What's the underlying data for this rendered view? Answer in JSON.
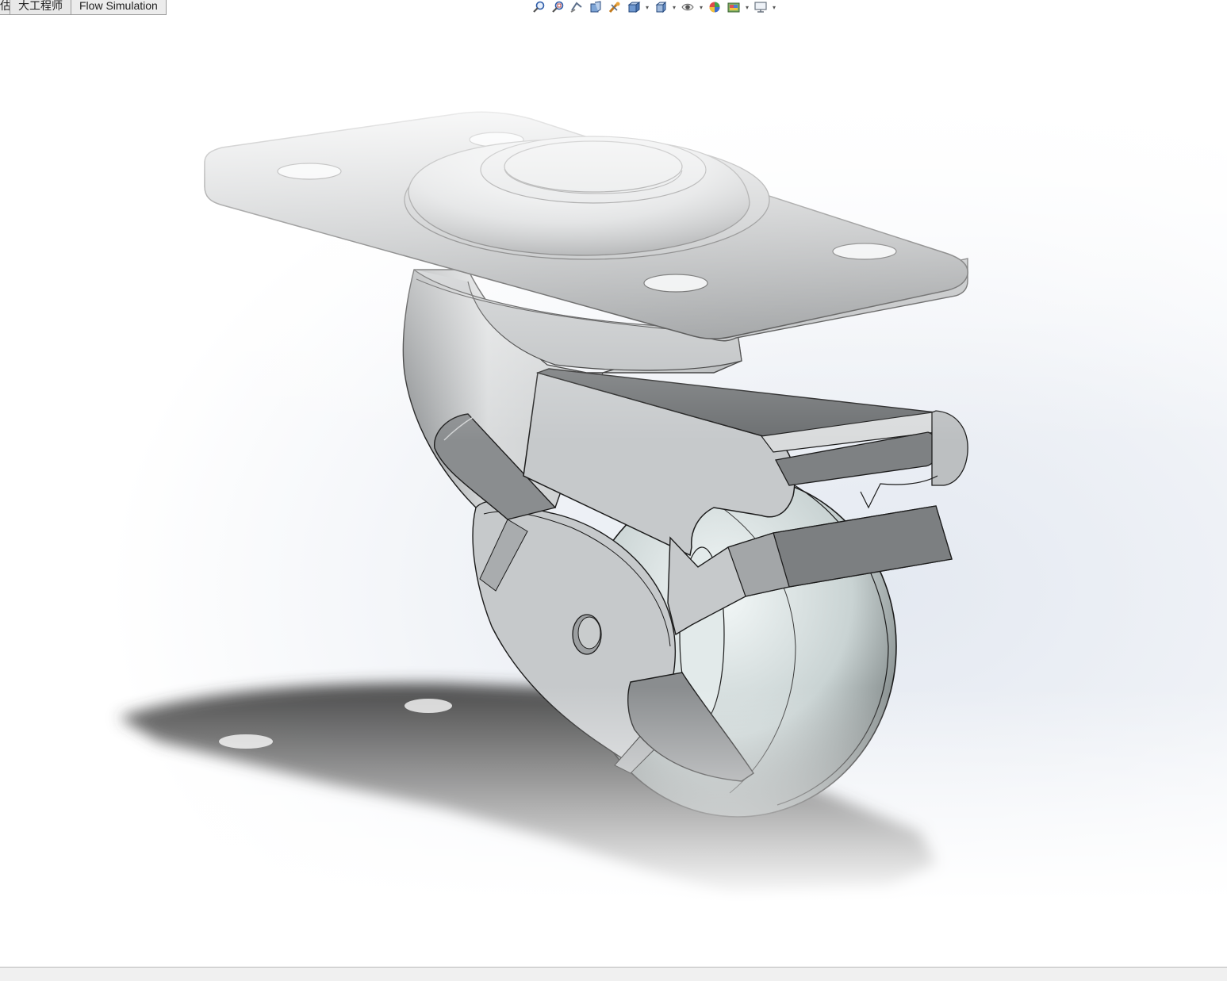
{
  "tabs": [
    {
      "label": "评估"
    },
    {
      "label": "大工程师"
    },
    {
      "label": "Flow Simulation"
    }
  ],
  "heads_up_toolbar": [
    {
      "icon": "zoom-to-fit-icon"
    },
    {
      "icon": "zoom-to-area-icon"
    },
    {
      "icon": "previous-view-icon"
    },
    {
      "icon": "section-view-icon"
    },
    {
      "icon": "dynamic-annotation-views-icon"
    },
    {
      "icon": "view-orientation-icon",
      "dropdown": true
    },
    {
      "icon": "display-style-icon",
      "dropdown": true
    },
    {
      "icon": "hide-show-items-icon",
      "dropdown": true
    },
    {
      "icon": "edit-appearance-icon"
    },
    {
      "icon": "apply-scene-icon",
      "dropdown": true
    },
    {
      "icon": "view-settings-icon",
      "dropdown": true
    }
  ],
  "model": {
    "name": "swivel-caster-with-brake",
    "colors": {
      "steel_light": "#c8cbcd",
      "steel_mid": "#9a9d9f",
      "steel_dark": "#6c6f71",
      "wheel_light": "#eef4f4",
      "wheel_dark": "#5d6363",
      "edge": "#1c1c1c",
      "shadow": "#3d3d3d"
    }
  }
}
